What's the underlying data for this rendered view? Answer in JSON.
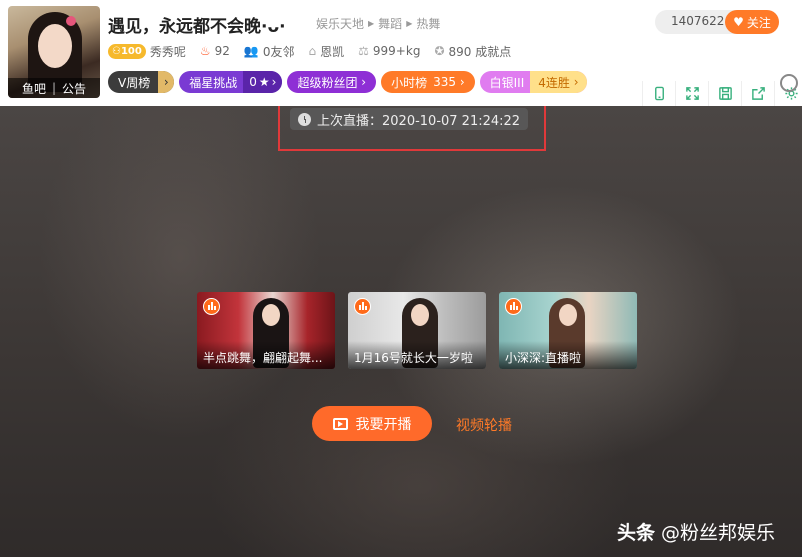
{
  "room": {
    "title": "遇见，永远都不会晚·ᴗ·",
    "breadcrumbs": [
      "娱乐天地",
      "舞蹈",
      "热舞"
    ],
    "avatar_links": [
      "鱼吧",
      "公告"
    ],
    "follower_count": "1407622",
    "follow_label": "关注"
  },
  "stats": {
    "level": "100",
    "nickname": "秀秀呢",
    "hot": "92",
    "friends": "0友邻",
    "location": "恩凯",
    "weight": "999+kg",
    "achievements": "890 成就点"
  },
  "badges": {
    "weekly": "V周榜",
    "star_challenge": "福星挑战",
    "star_count": "0",
    "fan_group": "超级粉丝团",
    "hourly": "小时榜",
    "hourly_rank": "335",
    "tier": "白银III",
    "streak": "4连胜"
  },
  "toolbar_icons": [
    "phone-icon",
    "fullscreen-icon",
    "save-icon",
    "share-icon",
    "settings-icon"
  ],
  "player": {
    "last_live": "上次直播：2020-10-07 21:24:22",
    "recommendations": [
      {
        "caption": "半点跳舞，翩翩起舞..."
      },
      {
        "caption": "1月16号就长大一岁啦"
      },
      {
        "caption": "小深深:直播啦"
      }
    ],
    "start_live_label": "我要开播",
    "video_carousel_label": "视频轮播"
  },
  "watermark": {
    "brand": "头条",
    "handle": "@粉丝邦娱乐"
  },
  "colors": {
    "accent": "#ff7a28",
    "tool_green": "#39b07e",
    "highlight_red": "#e0393a"
  }
}
